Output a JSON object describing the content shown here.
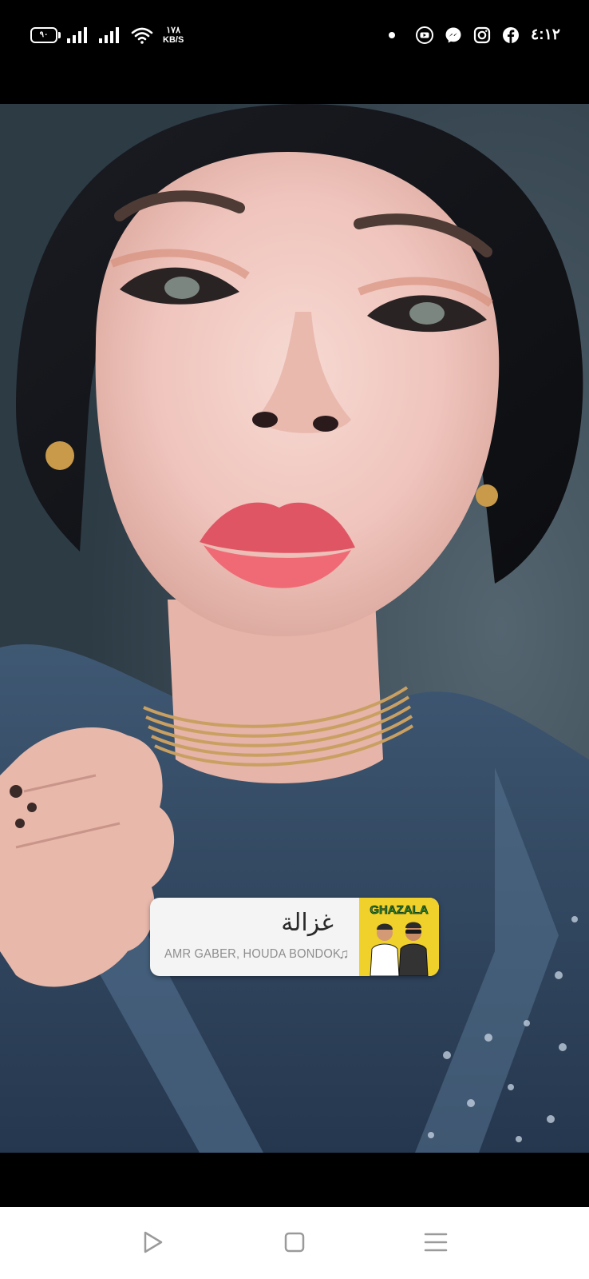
{
  "status_bar": {
    "battery_level": "٩٠",
    "network_speed_value": "١٧٨",
    "network_speed_unit": "KB/S",
    "time": "٤:١٢",
    "notification_icons": [
      "notification-dot-icon",
      "youtube-icon",
      "messenger-icon",
      "instagram-icon",
      "facebook-icon"
    ]
  },
  "story": {
    "music_sticker": {
      "title": "غزالة",
      "artist": "AMR GABER, HOUDA BONDOK",
      "note_icon": "♫",
      "album_art_title": "GHAZALA"
    }
  },
  "nav_bar": {
    "buttons": [
      "back-triangle-icon",
      "home-square-icon",
      "menu-lines-icon"
    ]
  },
  "colors": {
    "status_bar_bg": "#000000",
    "nav_bar_bg": "#ffffff",
    "sticker_bg": "#f4f4f4",
    "album_art_bg": "#f0d02a",
    "nav_icon": "#9a9a9a"
  }
}
